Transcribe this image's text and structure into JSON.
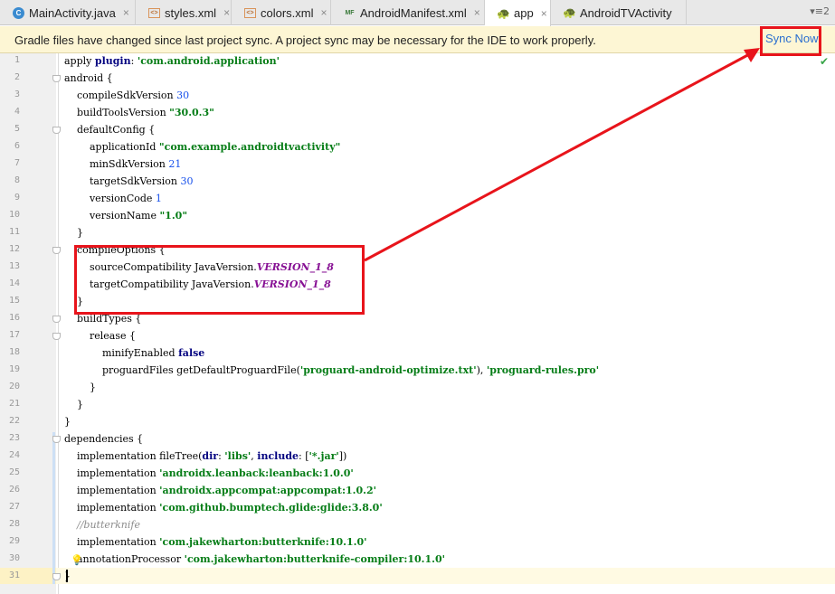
{
  "tabs": [
    {
      "label": "MainActivity.java",
      "icon": "class-icon",
      "icon_text": "C",
      "close": "×"
    },
    {
      "label": "styles.xml",
      "icon": "xml-icon",
      "icon_text": "<>",
      "close": "×"
    },
    {
      "label": "colors.xml",
      "icon": "xml-icon",
      "icon_text": "<>",
      "close": "×"
    },
    {
      "label": "AndroidManifest.xml",
      "icon": "manifest-icon",
      "icon_text": "MF",
      "close": "×"
    },
    {
      "label": "app",
      "icon": "android-icon",
      "icon_text": "🐢",
      "close": "×"
    },
    {
      "label": "AndroidTVActivity",
      "icon": "android-icon",
      "icon_text": "🐢",
      "close": ""
    }
  ],
  "tab_menu": "▾≡2",
  "banner": {
    "message": "Gradle files have changed since last project sync. A project sync may be necessary for the IDE to work properly.",
    "action": "Sync Now"
  },
  "editor": {
    "line_numbers": [
      "1",
      "2",
      "3",
      "4",
      "5",
      "6",
      "7",
      "8",
      "9",
      "10",
      "11",
      "12",
      "13",
      "14",
      "15",
      "16",
      "17",
      "18",
      "19",
      "20",
      "21",
      "22",
      "23",
      "24",
      "25",
      "26",
      "27",
      "28",
      "29",
      "30",
      "31"
    ],
    "lines": [
      [
        {
          "t": "apply ",
          "c": ""
        },
        {
          "t": "plugin",
          "c": "kw"
        },
        {
          "t": ": ",
          "c": ""
        },
        {
          "t": "'com.android.application'",
          "c": "str"
        }
      ],
      [
        {
          "t": "android {",
          "c": ""
        }
      ],
      [
        {
          "t": "    compileSdkVersion ",
          "c": ""
        },
        {
          "t": "30",
          "c": "num"
        }
      ],
      [
        {
          "t": "    buildToolsVersion ",
          "c": ""
        },
        {
          "t": "\"30.0.3\"",
          "c": "str"
        }
      ],
      [
        {
          "t": "    defaultConfig {",
          "c": ""
        }
      ],
      [
        {
          "t": "        applicationId ",
          "c": ""
        },
        {
          "t": "\"com.example.androidtvactivity\"",
          "c": "str"
        }
      ],
      [
        {
          "t": "        minSdkVersion ",
          "c": ""
        },
        {
          "t": "21",
          "c": "num"
        }
      ],
      [
        {
          "t": "        targetSdkVersion ",
          "c": ""
        },
        {
          "t": "30",
          "c": "num"
        }
      ],
      [
        {
          "t": "        versionCode ",
          "c": ""
        },
        {
          "t": "1",
          "c": "num"
        }
      ],
      [
        {
          "t": "        versionName ",
          "c": ""
        },
        {
          "t": "\"1.0\"",
          "c": "str"
        }
      ],
      [
        {
          "t": "    }",
          "c": ""
        }
      ],
      [
        {
          "t": "    compileOptions {",
          "c": ""
        }
      ],
      [
        {
          "t": "        sourceCompatibility JavaVersion.",
          "c": ""
        },
        {
          "t": "VERSION_1_8",
          "c": "const"
        }
      ],
      [
        {
          "t": "        targetCompatibility JavaVersion.",
          "c": ""
        },
        {
          "t": "VERSION_1_8",
          "c": "const"
        }
      ],
      [
        {
          "t": "    }",
          "c": ""
        }
      ],
      [
        {
          "t": "    buildTypes {",
          "c": ""
        }
      ],
      [
        {
          "t": "        release {",
          "c": ""
        }
      ],
      [
        {
          "t": "            minifyEnabled ",
          "c": ""
        },
        {
          "t": "false",
          "c": "kw"
        }
      ],
      [
        {
          "t": "            proguardFiles getDefaultProguardFile(",
          "c": ""
        },
        {
          "t": "'proguard-android-optimize.txt'",
          "c": "str"
        },
        {
          "t": "), ",
          "c": ""
        },
        {
          "t": "'proguard-rules.pro'",
          "c": "str"
        }
      ],
      [
        {
          "t": "        }",
          "c": ""
        }
      ],
      [
        {
          "t": "    }",
          "c": ""
        }
      ],
      [
        {
          "t": "}",
          "c": ""
        }
      ],
      [
        {
          "t": "dependencies {",
          "c": ""
        }
      ],
      [
        {
          "t": "    implementation fileTree(",
          "c": ""
        },
        {
          "t": "dir",
          "c": "kw"
        },
        {
          "t": ": ",
          "c": ""
        },
        {
          "t": "'libs'",
          "c": "str"
        },
        {
          "t": ", ",
          "c": ""
        },
        {
          "t": "include",
          "c": "kw"
        },
        {
          "t": ": [",
          "c": ""
        },
        {
          "t": "'*.jar'",
          "c": "str"
        },
        {
          "t": "])",
          "c": ""
        }
      ],
      [
        {
          "t": "    implementation ",
          "c": ""
        },
        {
          "t": "'androidx.leanback:leanback:1.0.0'",
          "c": "str"
        }
      ],
      [
        {
          "t": "    implementation ",
          "c": ""
        },
        {
          "t": "'androidx.appcompat:appcompat:1.0.2'",
          "c": "str"
        }
      ],
      [
        {
          "t": "    implementation ",
          "c": ""
        },
        {
          "t": "'com.github.bumptech.glide:glide:3.8.0'",
          "c": "str"
        }
      ],
      [
        {
          "t": "    //butterknife",
          "c": "cmt"
        }
      ],
      [
        {
          "t": "    implementation ",
          "c": ""
        },
        {
          "t": "'com.jakewharton:butterknife:10.1.0'",
          "c": "str"
        }
      ],
      [
        {
          "t": "    annotationProcessor ",
          "c": ""
        },
        {
          "t": "'com.jakewharton:butterknife-compiler:10.1.0'",
          "c": "str"
        }
      ],
      [
        {
          "t": "}",
          "c": ""
        }
      ]
    ]
  },
  "colors": {
    "annotation_red": "#e8141b",
    "string_green": "#067d17",
    "keyword_navy": "#000080",
    "number_blue": "#1750eb",
    "constant_purple": "#871094",
    "banner_bg": "#fdf6d4"
  }
}
